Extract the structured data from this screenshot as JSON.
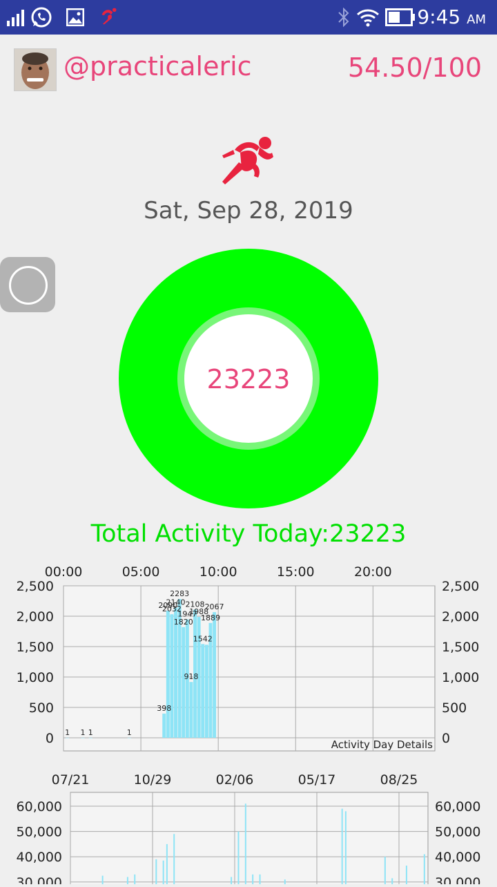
{
  "status_bar": {
    "time": "9:45",
    "ampm": "AM",
    "icons": [
      "signal-icon",
      "whatsapp-icon",
      "gallery-icon",
      "runner-notification-icon",
      "bluetooth-icon",
      "wifi-icon",
      "battery-icon"
    ]
  },
  "profile": {
    "username": "@practicaleric",
    "score": "54.50/100"
  },
  "date": "Sat, Sep 28, 2019",
  "ring": {
    "value": "23223",
    "outer_color": "#00ff00",
    "inner_color": "#78f678"
  },
  "total_activity": "Total Activity Today:23223",
  "colors": {
    "accent": "#e8457a",
    "green": "#00e000",
    "bar": "#8ee4f6",
    "statusbar": "#2d3c9f"
  },
  "chart_data": [
    {
      "type": "bar",
      "caption": "Activity Day Details",
      "x_tick_labels": [
        "00:00",
        "05:00",
        "10:00",
        "15:00",
        "20:00"
      ],
      "x_ticks_hours": [
        0,
        5,
        10,
        15,
        20
      ],
      "xlim_hours": [
        0,
        24
      ],
      "y_tick_labels": [
        "2,500",
        "2,000",
        "1,500",
        "1,000",
        "500",
        "0"
      ],
      "ylim": [
        0,
        2500
      ],
      "grid": true,
      "x_hours": [
        0.25,
        1.25,
        1.75,
        4.25,
        6.5,
        6.75,
        7.0,
        7.25,
        7.5,
        7.75,
        8.0,
        8.25,
        8.5,
        8.75,
        9.0,
        9.25,
        9.5,
        9.75
      ],
      "values": [
        1,
        1,
        1,
        1,
        398,
        2090,
        2032,
        2140,
        2283,
        1820,
        1947,
        918,
        2108,
        1988,
        1542,
        1530,
        1889,
        2067
      ],
      "labels": [
        "1",
        "1",
        "1",
        "1",
        "398",
        "2090",
        "2032",
        "2140",
        "2283",
        "1820",
        "1947",
        "918",
        "2108",
        "1988",
        "1542",
        "",
        "1889",
        "2067"
      ]
    },
    {
      "type": "bar",
      "x_tick_labels": [
        "07/21",
        "10/29",
        "02/06",
        "05/17",
        "08/25"
      ],
      "y_tick_labels": [
        "60,000",
        "50,000",
        "40,000",
        "30,000"
      ],
      "ylim_visible": [
        30000,
        60000
      ],
      "grid": true,
      "x_fraction": [
        0.09,
        0.16,
        0.18,
        0.24,
        0.26,
        0.27,
        0.29,
        0.45,
        0.47,
        0.49,
        0.51,
        0.53,
        0.6,
        0.76,
        0.77,
        0.88,
        0.9,
        0.94,
        0.99
      ],
      "values": [
        32500,
        32000,
        33000,
        39000,
        38500,
        45000,
        49000,
        32000,
        50000,
        61000,
        33000,
        33000,
        31000,
        59000,
        58000,
        40000,
        31500,
        36500,
        41000
      ]
    }
  ]
}
